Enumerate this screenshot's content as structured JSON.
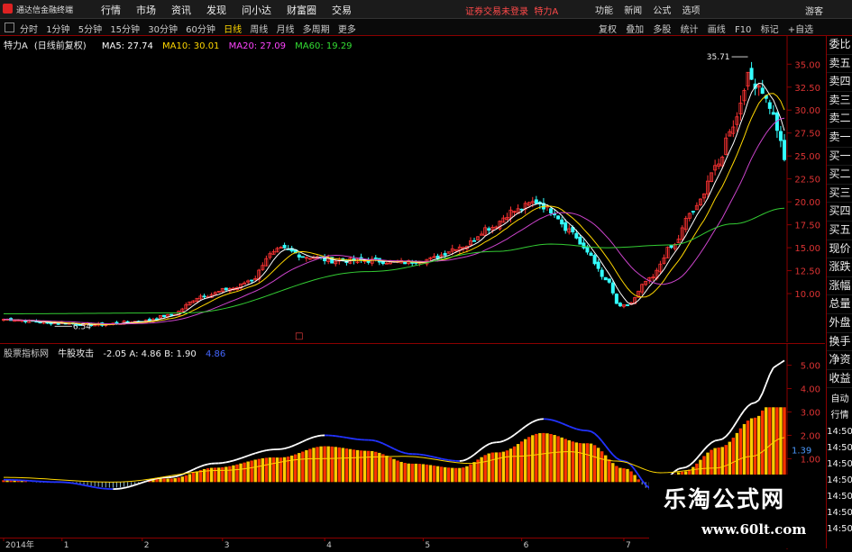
{
  "app": {
    "title": "通达信金融终端",
    "menus": [
      "行情",
      "市场",
      "资讯",
      "发现",
      "问小达",
      "财富圈",
      "交易"
    ],
    "login_notice": "证券交易未登录",
    "stock_name": "特力A",
    "right_menus": [
      "功能",
      "新闻",
      "公式",
      "选项"
    ],
    "guest": "游客"
  },
  "periodbar": {
    "periods": [
      "分时",
      "1分钟",
      "5分钟",
      "15分钟",
      "30分钟",
      "60分钟",
      "日线",
      "周线",
      "月线",
      "多周期",
      "更多"
    ],
    "active": "日线",
    "tools": [
      "复权",
      "叠加",
      "多股",
      "统计",
      "画线",
      "F10",
      "标记",
      "+自选"
    ]
  },
  "main_legend": {
    "name": "特力A",
    "adjust": "(日线前复权)",
    "ma": [
      {
        "label": "MA5: 27.74",
        "color": "#ffffff"
      },
      {
        "label": "MA10: 30.01",
        "color": "#ffd700"
      },
      {
        "label": "MA20: 27.09",
        "color": "#ff44ff"
      },
      {
        "label": "MA60: 19.29",
        "color": "#33dd33"
      }
    ]
  },
  "sub_legend": {
    "name": "股票指标网",
    "indicator": "牛股攻击",
    "values": "-2.05  A: 4.86  B: 1.90",
    "extra": "4.86"
  },
  "sidebar": {
    "quote_tabs": [
      "委比",
      "卖五",
      "卖四",
      "卖三",
      "卖二",
      "卖一",
      "买一",
      "买二",
      "买三",
      "买四",
      "买五",
      "现价",
      "涨跌",
      "涨幅",
      "总量",
      "外盘",
      "换手",
      "净资",
      "收益"
    ],
    "sub_tabs": [
      "自动",
      "行情",
      "14:50",
      "14:50",
      "14:50",
      "14:50",
      "14:50",
      "14:50",
      "14:50"
    ]
  },
  "watermark": {
    "line1": "乐淘公式网",
    "line2": "www.60lt.com"
  },
  "chart_data": [
    {
      "type": "candlestick",
      "title": "特力A",
      "xlabel": "",
      "ylabel": "",
      "ylim": [
        5,
        36.5
      ],
      "y_ticks": [
        "35.00",
        "32.50",
        "30.00",
        "27.50",
        "25.00",
        "22.50",
        "20.00",
        "17.50",
        "15.00",
        "12.50",
        "10.00"
      ],
      "annotations": {
        "high": "35.71",
        "low": "6.54",
        "marker": "□"
      },
      "colors": {
        "up": "#ff3333",
        "down": "#33ffff",
        "ma5": "#ffffff",
        "ma10": "#ffd700",
        "ma20": "#cc44cc",
        "ma60": "#33cc33"
      },
      "close_keypoints": [
        [
          0,
          7.2
        ],
        [
          14,
          6.8
        ],
        [
          25,
          6.6
        ],
        [
          38,
          7.0
        ],
        [
          45,
          7.6
        ],
        [
          55,
          9.8
        ],
        [
          63,
          10.6
        ],
        [
          68,
          11.5
        ],
        [
          73,
          14.2
        ],
        [
          76,
          14.8
        ],
        [
          84,
          14.0
        ],
        [
          90,
          13.6
        ],
        [
          100,
          13.6
        ],
        [
          110,
          13.4
        ],
        [
          116,
          13.7
        ],
        [
          126,
          15.2
        ],
        [
          133,
          17.2
        ],
        [
          140,
          19.0
        ],
        [
          146,
          20.0
        ],
        [
          150,
          19.1
        ],
        [
          155,
          17.0
        ],
        [
          160,
          14.5
        ],
        [
          165,
          11.5
        ],
        [
          169,
          8.5
        ],
        [
          171,
          8.8
        ],
        [
          177,
          11.5
        ],
        [
          183,
          15.0
        ],
        [
          189,
          19.0
        ],
        [
          195,
          23.5
        ],
        [
          200,
          28.5
        ],
        [
          204,
          33.5
        ],
        [
          207,
          32.8
        ],
        [
          210,
          30.5
        ],
        [
          212,
          28.0
        ],
        [
          214,
          24.5
        ]
      ],
      "ma60_keypoints": [
        [
          0,
          7.8
        ],
        [
          50,
          7.9
        ],
        [
          100,
          12.4
        ],
        [
          135,
          14.6
        ],
        [
          150,
          15.4
        ],
        [
          165,
          15.0
        ],
        [
          183,
          15.3
        ],
        [
          200,
          17.6
        ],
        [
          214,
          19.3
        ]
      ]
    },
    {
      "type": "line",
      "title": "牛股攻击",
      "xlabel": "",
      "ylabel": "",
      "ylim": [
        -2.8,
        5.6
      ],
      "y_ticks": [
        "5.00",
        "4.00",
        "3.00",
        "2.00",
        "1.00"
      ],
      "current_label": "1.39",
      "series": [
        {
          "name": "A",
          "color": "#ffffff",
          "keypoints": [
            [
              0,
              0.1
            ],
            [
              15,
              0.0
            ],
            [
              30,
              -0.3
            ],
            [
              45,
              0.2
            ],
            [
              58,
              0.8
            ],
            [
              75,
              1.4
            ],
            [
              88,
              2.0
            ],
            [
              100,
              1.8
            ],
            [
              112,
              1.2
            ],
            [
              125,
              0.9
            ],
            [
              135,
              1.7
            ],
            [
              148,
              2.7
            ],
            [
              160,
              2.2
            ],
            [
              170,
              0.9
            ],
            [
              178,
              -0.3
            ],
            [
              186,
              0.6
            ],
            [
              196,
              1.8
            ],
            [
              206,
              3.4
            ],
            [
              212,
              5.0
            ],
            [
              214,
              5.2
            ]
          ]
        },
        {
          "name": "B",
          "color": "#ffd700",
          "keypoints": [
            [
              0,
              0.2
            ],
            [
              30,
              0.0
            ],
            [
              60,
              0.5
            ],
            [
              85,
              1.0
            ],
            [
              110,
              1.1
            ],
            [
              128,
              0.8
            ],
            [
              140,
              1.1
            ],
            [
              155,
              1.3
            ],
            [
              168,
              0.9
            ],
            [
              180,
              0.4
            ],
            [
              195,
              0.6
            ],
            [
              205,
              1.1
            ],
            [
              214,
              1.9
            ]
          ]
        }
      ]
    }
  ],
  "x_axis_labels": [
    "2014年",
    "1",
    "2",
    "3",
    "4",
    "5",
    "6",
    "7"
  ]
}
